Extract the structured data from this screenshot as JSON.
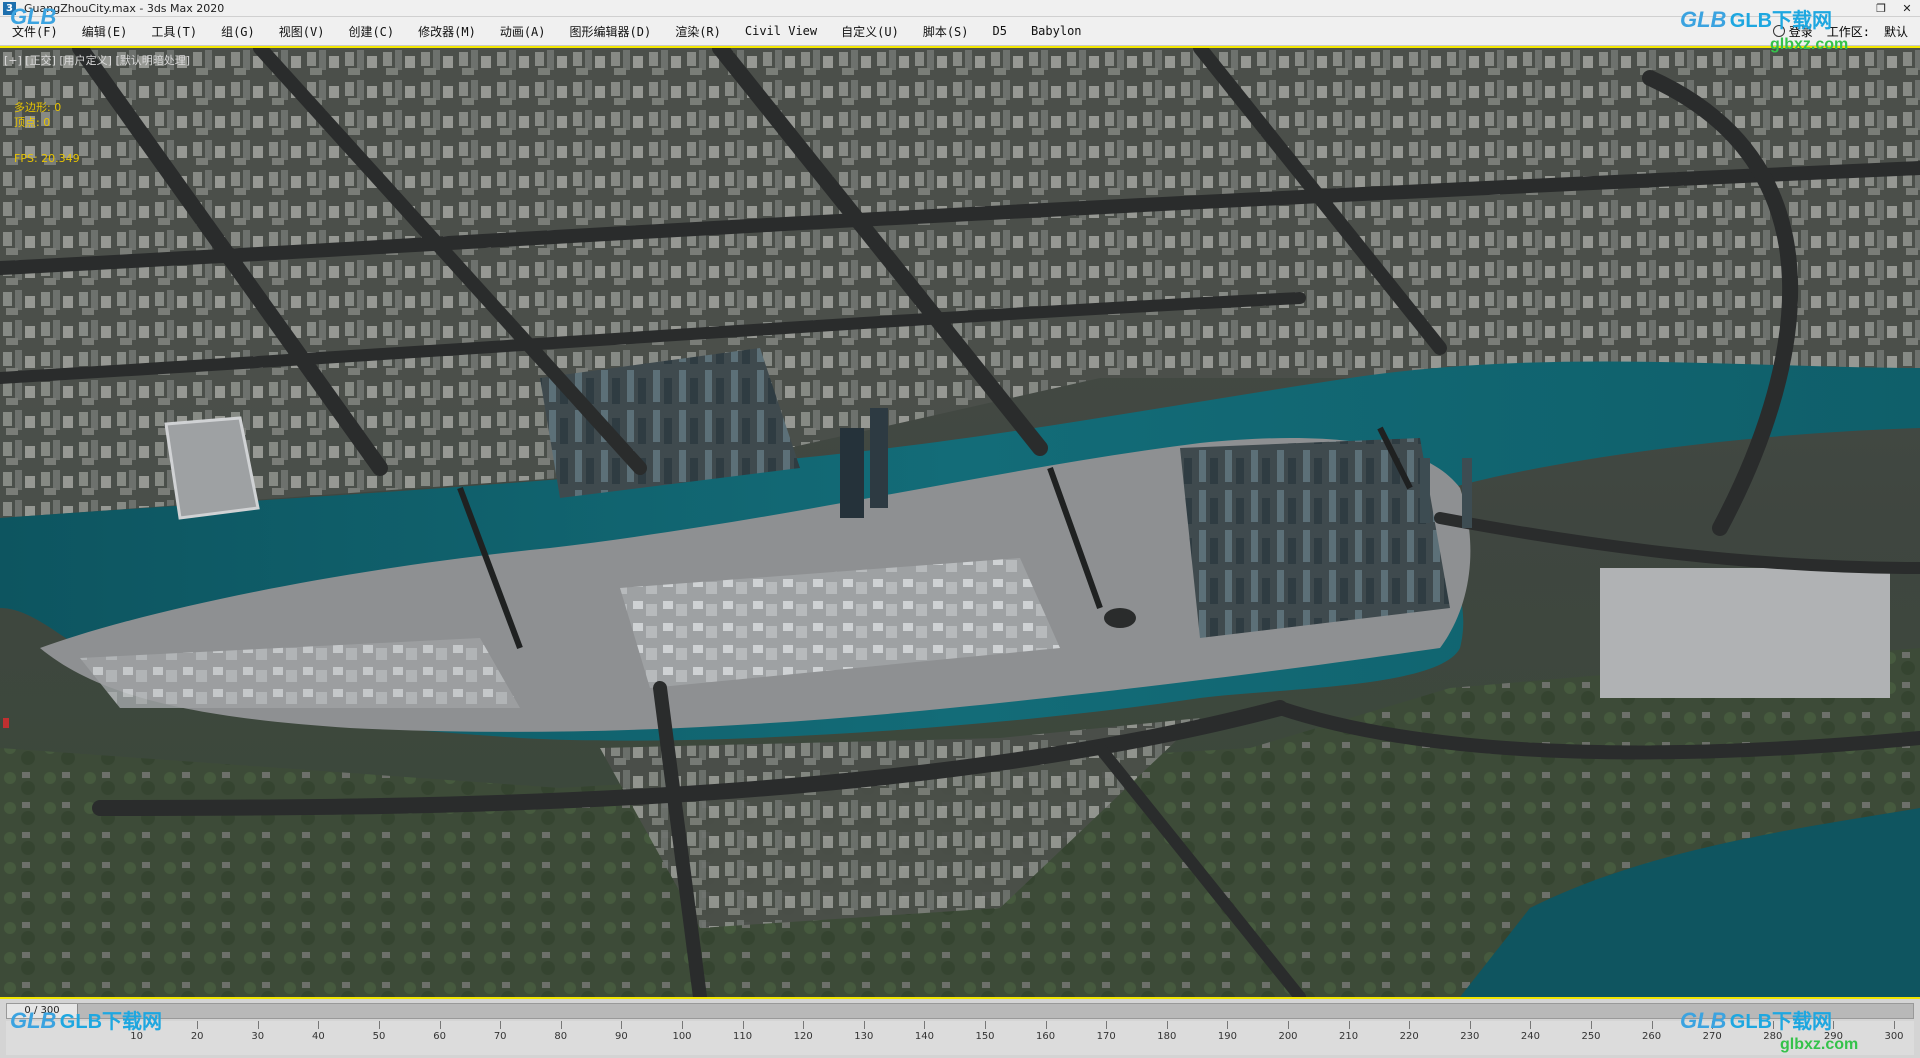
{
  "window": {
    "title": "GuangZhouCity.max - 3ds Max 2020",
    "app_icon": "3"
  },
  "menu": [
    {
      "label": "文件(F)"
    },
    {
      "label": "编辑(E)"
    },
    {
      "label": "工具(T)"
    },
    {
      "label": "组(G)"
    },
    {
      "label": "视图(V)"
    },
    {
      "label": "创建(C)"
    },
    {
      "label": "修改器(M)"
    },
    {
      "label": "动画(A)"
    },
    {
      "label": "图形编辑器(D)"
    },
    {
      "label": "渲染(R)"
    },
    {
      "label": "Civil View"
    },
    {
      "label": "自定义(U)"
    },
    {
      "label": "脚本(S)"
    },
    {
      "label": "D5"
    },
    {
      "label": "Babylon"
    }
  ],
  "menu_right": {
    "login": "登录",
    "workspace_label": "工作区:",
    "workspace_value": "默认"
  },
  "viewport": {
    "label": "[+] [正交] [用户定义] [默认明暗处理]",
    "stats": {
      "polys_label": "多边形:",
      "polys_value": "0",
      "verts_label": "顶点:",
      "verts_value": "0"
    },
    "fps_label": "FPS:",
    "fps_value": "20.349"
  },
  "timeline": {
    "slider_text": "0 / 300",
    "ticks": [
      "10",
      "20",
      "30",
      "40",
      "50",
      "60",
      "70",
      "80",
      "90",
      "100",
      "110",
      "120",
      "130",
      "140",
      "150",
      "160",
      "170",
      "180",
      "190",
      "200",
      "210",
      "220",
      "230",
      "240",
      "250",
      "260",
      "270",
      "280",
      "290",
      "300"
    ]
  },
  "watermark": {
    "logo": "GLB",
    "text": "GLB下载网",
    "url": "glbxz.com"
  },
  "colors": {
    "viewport_border": "#f2e600",
    "river": "#0f5f6a",
    "roads": "#2c2e2e",
    "ground": "#3e4540"
  }
}
